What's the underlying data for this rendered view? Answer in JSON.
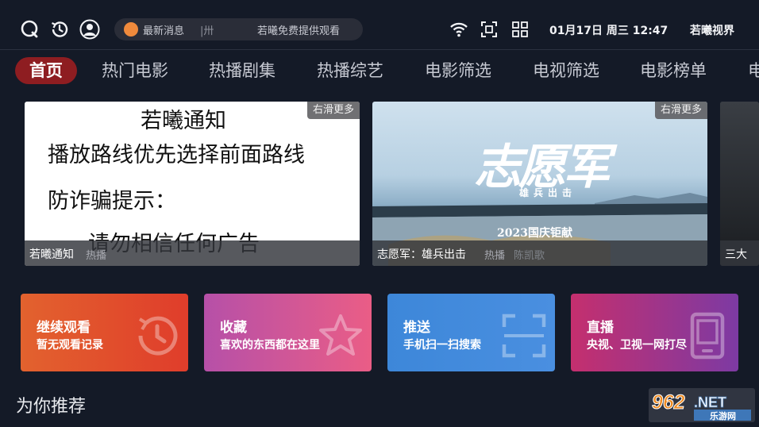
{
  "status_bar": {
    "news_label": "最新消息",
    "news_fragment": "|卅",
    "news_message": "若曦免费提供观看",
    "datetime": "01月17日 周三 12:47",
    "brand": "若曦视界"
  },
  "tabs": [
    {
      "label": "首页",
      "active": true
    },
    {
      "label": "热门电影"
    },
    {
      "label": "热播剧集"
    },
    {
      "label": "热播综艺"
    },
    {
      "label": "电影筛选"
    },
    {
      "label": "电视筛选"
    },
    {
      "label": "电影榜单"
    },
    {
      "label": "电"
    }
  ],
  "banners": [
    {
      "kind": "notice",
      "badge": "右滑更多",
      "lines": [
        "若曦通知",
        "播放路线优先选择前面路线",
        "防诈骗提示：",
        "请勿相信任何广告"
      ],
      "caption": "若曦通知",
      "tag": "热播"
    },
    {
      "kind": "movie",
      "badge": "右滑更多",
      "poster_title": "志愿军",
      "poster_subtitle": "雄兵出击",
      "poster_year": "2023国庆钜献",
      "poster_credit": "陈凯歌",
      "caption": "志愿军：雄兵出击",
      "tag": "热播"
    },
    {
      "kind": "partial",
      "caption": "三大"
    }
  ],
  "features": [
    {
      "title": "继续观看",
      "subtitle": "暂无观看记录",
      "icon": "history-icon",
      "color_from": "#e2622e",
      "color_to": "#e03d2b"
    },
    {
      "title": "收藏",
      "subtitle": "喜欢的东西都在这里",
      "icon": "star-icon",
      "color_from": "#b650a8",
      "color_to": "#ea5d86"
    },
    {
      "title": "推送",
      "subtitle": "手机扫一扫搜索",
      "icon": "scan-icon",
      "color_from": "#3d87d9",
      "color_to": "#4a8fe0"
    },
    {
      "title": "直播",
      "subtitle": "央视、卫视一网打尽",
      "icon": "tablet-icon",
      "color_from": "#c42f6e",
      "color_to": "#7d3aa3"
    }
  ],
  "section": {
    "title": "为你推荐"
  },
  "watermark": {
    "number": "962.NET",
    "site": "乐游网"
  }
}
